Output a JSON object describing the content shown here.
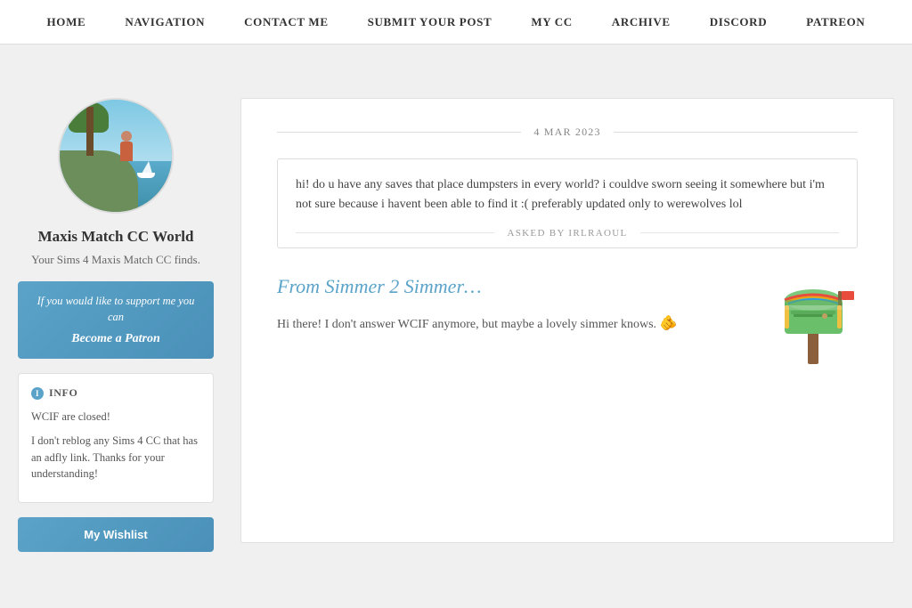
{
  "nav": {
    "items": [
      {
        "label": "HOME",
        "href": "#",
        "active": false
      },
      {
        "label": "NAVIGATION",
        "href": "#",
        "active": false
      },
      {
        "label": "CONTACT ME",
        "href": "#",
        "active": true
      },
      {
        "label": "SUBMIT YOUR POST",
        "href": "#",
        "active": false
      },
      {
        "label": "MY CC",
        "href": "#",
        "active": false
      },
      {
        "label": "ARCHIVE",
        "href": "#",
        "active": false
      },
      {
        "label": "DISCORD",
        "href": "#",
        "active": false
      },
      {
        "label": "PATREON",
        "href": "#",
        "active": false
      }
    ]
  },
  "sidebar": {
    "title": "Maxis Match CC World",
    "subtitle": "Your Sims 4 Maxis Match CC finds.",
    "patron_support_text": "If you would like to support me you can",
    "patron_link_text": "Become a Patron",
    "info_header": "INFO",
    "info_lines": [
      "WCIF are closed!",
      "I don't reblog any Sims 4 CC that has an adfly link. Thanks for your understanding!"
    ],
    "wishlist_label": "My Wishlist"
  },
  "post": {
    "date": "4 MAR 2023",
    "question": "hi! do u have any saves that place dumpsters in every world? i couldve sworn seeing it somewhere but i'm not sure because i havent been able to find it :( preferably updated only to werewolves lol",
    "asked_by": "ASKED BY IRLRAOUL",
    "response_title": "From Simmer 2 Simmer…",
    "response_text": "Hi there! I don't answer WCIF anymore, but maybe a lovely simmer knows.",
    "response_emoji": "🫵"
  }
}
